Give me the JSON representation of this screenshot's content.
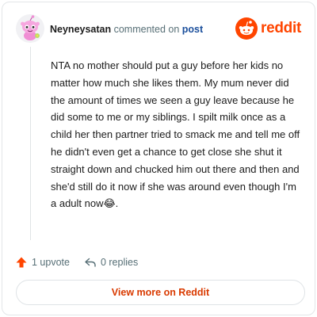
{
  "header": {
    "username": "Neyneysatan",
    "action_text": "commented on",
    "target_text": "post",
    "brand": "reddit",
    "avatar_icon": "pink-snoo-avatar-icon",
    "brand_icon": "reddit-snoo-icon"
  },
  "comment": {
    "text": "NTA no mother should put a guy before her kids no matter how much she likes them. My mum never did the amount of times we seen a guy leave because he did some to me or my siblings. I spilt milk once as a child her then partner tried to smack me and tell me off he didn't even get a chance to get close she shut it straight down and chucked him out there and then and she'd still do it now if she was around even though I'm a adult now😂."
  },
  "actions": {
    "upvote_label": "1 upvote",
    "replies_label": "0 replies",
    "upvote_icon": "upvote-arrow-icon",
    "reply_icon": "reply-arrow-icon"
  },
  "footer": {
    "view_button_label": "View more on Reddit"
  },
  "colors": {
    "brand_orange": "#ff4500",
    "link_blue": "#1b4f9c",
    "muted": "#576f76",
    "button_text": "#d93a00"
  }
}
